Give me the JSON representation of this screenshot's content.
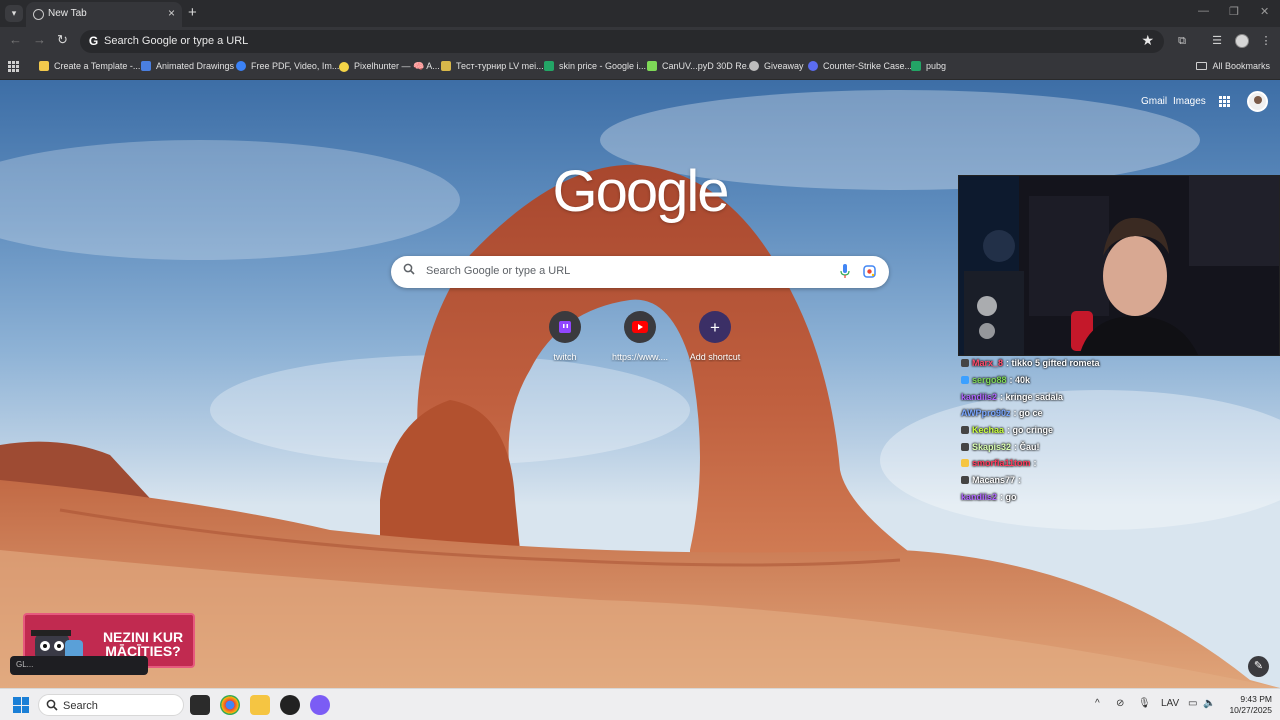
{
  "browser": {
    "tab_title": "New Tab",
    "close_glyph": "×",
    "newtab_glyph": "+",
    "omnibox_placeholder": "Search Google or type a URL",
    "star_glyph": "★"
  },
  "bookmarks": [
    {
      "label": "Create a Template -...",
      "color": "#f2c94c"
    },
    {
      "label": "Animated Drawings",
      "color": "#4a7fe0"
    },
    {
      "label": "Free PDF, Video, Im...",
      "color": "#3b82f6"
    },
    {
      "label": "Pixelhunter — 🧠 A...",
      "color": "#f5d547"
    },
    {
      "label": "Тест-турнир LV mei...",
      "color": "#d8b84a"
    },
    {
      "label": "skin price - Google i...",
      "color": "#23a566"
    },
    {
      "label": "CanUV...pyD 30D Re...",
      "color": "#7ed957"
    },
    {
      "label": "Giveaway",
      "color": "#bdbdbd"
    },
    {
      "label": "Counter-Strike Case...",
      "color": "#5b6cf0"
    },
    {
      "label": "pubg",
      "color": "#23a566"
    }
  ],
  "all_bookmarks_label": "All Bookmarks",
  "ntp": {
    "gmail": "Gmail",
    "images": "Images",
    "logo": "Google",
    "search_placeholder": "Search Google or type a URL",
    "shortcuts": [
      {
        "label": "twitch",
        "bg": "#3a3a3e",
        "icon": "twitch-icon"
      },
      {
        "label": "https://www....",
        "bg": "#3a3a3e",
        "icon": "youtube-icon"
      },
      {
        "label": "Add shortcut",
        "bg": "#3b2f66",
        "icon": "plus-icon"
      }
    ],
    "edit_glyph": "✎"
  },
  "overlay": {
    "chat": [
      {
        "user": "Marx_8",
        "msg": ": tikko 5 gifted rometa",
        "color": "#ff4d6d"
      },
      {
        "user": "sergo88",
        "msg": ": 40k",
        "color": "#7ed957"
      },
      {
        "user": "kandiis2",
        "msg": ": kringe sadala",
        "color": "#b065ff"
      },
      {
        "user": "AWPpro90z",
        "msg": ": go ce",
        "color": "#7aa7ff"
      },
      {
        "user": "Kechaa",
        "msg": ": go cringe",
        "color": "#c9ff3d"
      },
      {
        "user": "Skapis32",
        "msg": ": Čau!",
        "color": "#d9ffb0"
      },
      {
        "user": "smorfia11tom",
        "msg": ":",
        "color": "#ff3b5c"
      },
      {
        "user": "Macans77",
        "msg": ":",
        "color": "#ffffff"
      },
      {
        "user": "kandiis2",
        "msg": ": go",
        "color": "#b065ff"
      }
    ],
    "promo_line1": "NEZINI KUR",
    "promo_line2": "MĀCĪTIES?",
    "promo_strip": "GL..."
  },
  "taskbar": {
    "search": "Search",
    "lang": "LAV",
    "time": "9:43 PM",
    "date": "10/27/2025"
  }
}
